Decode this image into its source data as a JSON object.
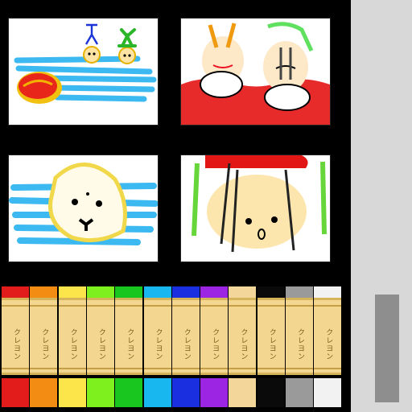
{
  "app": {
    "background": "#000000"
  },
  "panels": [
    {
      "id": "panel-1",
      "subject": "beach with red ball and two stick figures"
    },
    {
      "id": "panel-2",
      "subject": "two sleeping faces with red splash"
    },
    {
      "id": "panel-3",
      "subject": "yellow creature on blue water"
    },
    {
      "id": "panel-4",
      "subject": "upside-down face with green lines"
    }
  ],
  "crayons": [
    {
      "name": "red",
      "color": "#e21b1b",
      "label": "クレヨン"
    },
    {
      "name": "orange",
      "color": "#f28c12",
      "label": "クレヨン"
    },
    {
      "name": "yellow",
      "color": "#fbe54a",
      "label": "クレヨン"
    },
    {
      "name": "light-green",
      "color": "#7ef01e",
      "label": "クレヨン"
    },
    {
      "name": "green",
      "color": "#18c61f",
      "label": "クレヨン"
    },
    {
      "name": "cyan",
      "color": "#19b7f0",
      "label": "クレヨン"
    },
    {
      "name": "blue",
      "color": "#1a2fe0",
      "label": "クレヨン"
    },
    {
      "name": "purple",
      "color": "#9b25e3",
      "label": "クレヨン"
    },
    {
      "name": "beige",
      "color": "#f3d79a",
      "label": "クレヨン"
    },
    {
      "name": "black",
      "color": "#0a0a0a",
      "label": "クレヨン"
    },
    {
      "name": "gray",
      "color": "#9a9a9a",
      "label": "クレヨン"
    },
    {
      "name": "white",
      "color": "#f2f2f2",
      "label": "クレヨン"
    }
  ],
  "sidebar": {
    "color": "#d8d8d8",
    "scroll_color": "#8e8e8e"
  }
}
